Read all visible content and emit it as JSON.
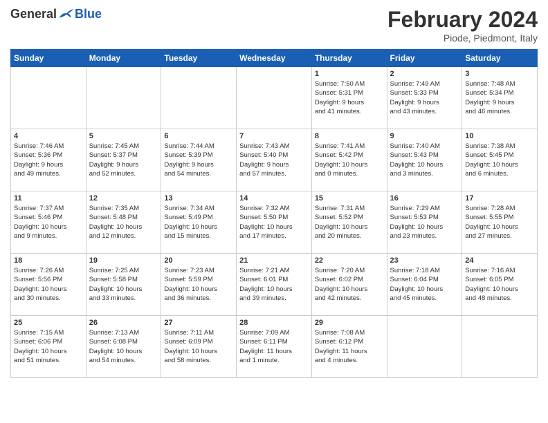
{
  "logo": {
    "general": "General",
    "blue": "Blue"
  },
  "title": {
    "month_year": "February 2024",
    "location": "Piode, Piedmont, Italy"
  },
  "days_of_week": [
    "Sunday",
    "Monday",
    "Tuesday",
    "Wednesday",
    "Thursday",
    "Friday",
    "Saturday"
  ],
  "weeks": [
    {
      "days": [
        {
          "num": "",
          "info": ""
        },
        {
          "num": "",
          "info": ""
        },
        {
          "num": "",
          "info": ""
        },
        {
          "num": "",
          "info": ""
        },
        {
          "num": "1",
          "info": "Sunrise: 7:50 AM\nSunset: 5:31 PM\nDaylight: 9 hours\nand 41 minutes."
        },
        {
          "num": "2",
          "info": "Sunrise: 7:49 AM\nSunset: 5:33 PM\nDaylight: 9 hours\nand 43 minutes."
        },
        {
          "num": "3",
          "info": "Sunrise: 7:48 AM\nSunset: 5:34 PM\nDaylight: 9 hours\nand 46 minutes."
        }
      ]
    },
    {
      "days": [
        {
          "num": "4",
          "info": "Sunrise: 7:46 AM\nSunset: 5:36 PM\nDaylight: 9 hours\nand 49 minutes."
        },
        {
          "num": "5",
          "info": "Sunrise: 7:45 AM\nSunset: 5:37 PM\nDaylight: 9 hours\nand 52 minutes."
        },
        {
          "num": "6",
          "info": "Sunrise: 7:44 AM\nSunset: 5:39 PM\nDaylight: 9 hours\nand 54 minutes."
        },
        {
          "num": "7",
          "info": "Sunrise: 7:43 AM\nSunset: 5:40 PM\nDaylight: 9 hours\nand 57 minutes."
        },
        {
          "num": "8",
          "info": "Sunrise: 7:41 AM\nSunset: 5:42 PM\nDaylight: 10 hours\nand 0 minutes."
        },
        {
          "num": "9",
          "info": "Sunrise: 7:40 AM\nSunset: 5:43 PM\nDaylight: 10 hours\nand 3 minutes."
        },
        {
          "num": "10",
          "info": "Sunrise: 7:38 AM\nSunset: 5:45 PM\nDaylight: 10 hours\nand 6 minutes."
        }
      ]
    },
    {
      "days": [
        {
          "num": "11",
          "info": "Sunrise: 7:37 AM\nSunset: 5:46 PM\nDaylight: 10 hours\nand 9 minutes."
        },
        {
          "num": "12",
          "info": "Sunrise: 7:35 AM\nSunset: 5:48 PM\nDaylight: 10 hours\nand 12 minutes."
        },
        {
          "num": "13",
          "info": "Sunrise: 7:34 AM\nSunset: 5:49 PM\nDaylight: 10 hours\nand 15 minutes."
        },
        {
          "num": "14",
          "info": "Sunrise: 7:32 AM\nSunset: 5:50 PM\nDaylight: 10 hours\nand 17 minutes."
        },
        {
          "num": "15",
          "info": "Sunrise: 7:31 AM\nSunset: 5:52 PM\nDaylight: 10 hours\nand 20 minutes."
        },
        {
          "num": "16",
          "info": "Sunrise: 7:29 AM\nSunset: 5:53 PM\nDaylight: 10 hours\nand 23 minutes."
        },
        {
          "num": "17",
          "info": "Sunrise: 7:28 AM\nSunset: 5:55 PM\nDaylight: 10 hours\nand 27 minutes."
        }
      ]
    },
    {
      "days": [
        {
          "num": "18",
          "info": "Sunrise: 7:26 AM\nSunset: 5:56 PM\nDaylight: 10 hours\nand 30 minutes."
        },
        {
          "num": "19",
          "info": "Sunrise: 7:25 AM\nSunset: 5:58 PM\nDaylight: 10 hours\nand 33 minutes."
        },
        {
          "num": "20",
          "info": "Sunrise: 7:23 AM\nSunset: 5:59 PM\nDaylight: 10 hours\nand 36 minutes."
        },
        {
          "num": "21",
          "info": "Sunrise: 7:21 AM\nSunset: 6:01 PM\nDaylight: 10 hours\nand 39 minutes."
        },
        {
          "num": "22",
          "info": "Sunrise: 7:20 AM\nSunset: 6:02 PM\nDaylight: 10 hours\nand 42 minutes."
        },
        {
          "num": "23",
          "info": "Sunrise: 7:18 AM\nSunset: 6:04 PM\nDaylight: 10 hours\nand 45 minutes."
        },
        {
          "num": "24",
          "info": "Sunrise: 7:16 AM\nSunset: 6:05 PM\nDaylight: 10 hours\nand 48 minutes."
        }
      ]
    },
    {
      "days": [
        {
          "num": "25",
          "info": "Sunrise: 7:15 AM\nSunset: 6:06 PM\nDaylight: 10 hours\nand 51 minutes."
        },
        {
          "num": "26",
          "info": "Sunrise: 7:13 AM\nSunset: 6:08 PM\nDaylight: 10 hours\nand 54 minutes."
        },
        {
          "num": "27",
          "info": "Sunrise: 7:11 AM\nSunset: 6:09 PM\nDaylight: 10 hours\nand 58 minutes."
        },
        {
          "num": "28",
          "info": "Sunrise: 7:09 AM\nSunset: 6:11 PM\nDaylight: 11 hours\nand 1 minute."
        },
        {
          "num": "29",
          "info": "Sunrise: 7:08 AM\nSunset: 6:12 PM\nDaylight: 11 hours\nand 4 minutes."
        },
        {
          "num": "",
          "info": ""
        },
        {
          "num": "",
          "info": ""
        }
      ]
    }
  ]
}
